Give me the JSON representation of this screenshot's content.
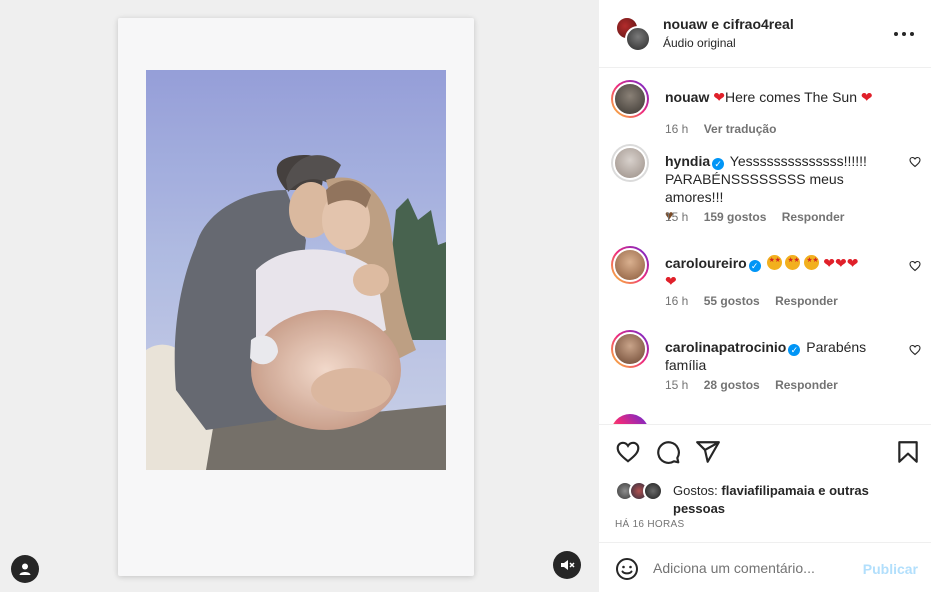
{
  "header": {
    "title": "nouaw e cifrao4real",
    "subtitle": "Áudio original"
  },
  "comments": [
    {
      "user": "nouaw",
      "verified": false,
      "text_parts": [
        "❤",
        "Here comes The Sun",
        "❤"
      ],
      "time": "16 h",
      "action": "Ver tradução"
    },
    {
      "user": "hyndia",
      "verified": true,
      "text": "Yessssssssssssss!!!!!! PARABÉNSSSSSSSS meus amores!!!",
      "emoji": "♥",
      "time": "15 h",
      "likes": "159 gostos",
      "action": "Responder"
    },
    {
      "user": "caroloureiro",
      "verified": true,
      "emoji_hearts": "❤❤❤",
      "emoji_heart_last": "❤",
      "time": "16 h",
      "likes": "55 gostos",
      "action": "Responder"
    },
    {
      "user": "carolinapatrocinio",
      "verified": true,
      "text": "Parabéns família",
      "time": "15 h",
      "likes": "28 gostos",
      "action": "Responder"
    }
  ],
  "likes": {
    "prefix": "Gostos:",
    "user": "flaviafilipamaia",
    "suffix": "e outras pessoas"
  },
  "time_ago": "HÁ 16 HORAS",
  "composer": {
    "placeholder": "Adiciona um comentário...",
    "publish_label": "Publicar"
  },
  "colors": {
    "accent": "#0095f6",
    "publish_disabled": "#b2dffc",
    "heart": "#e0202a",
    "story_ring": [
      "#f9ce34",
      "#ee2a7b",
      "#6228d7"
    ]
  }
}
